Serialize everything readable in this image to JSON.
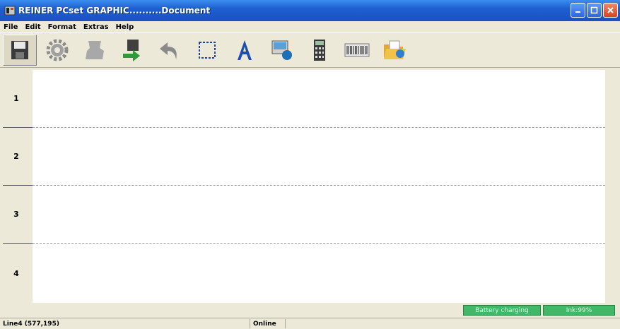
{
  "window": {
    "title": "REINER PCset GRAPHIC..........Document"
  },
  "menu": {
    "items": [
      "File",
      "Edit",
      "Format",
      "Extras",
      "Help"
    ]
  },
  "toolbar": {
    "tools": [
      "save-icon",
      "gear-icon",
      "stamp-icon",
      "print-transfer-icon",
      "undo-icon",
      "selection-rectangle-icon",
      "text-icon",
      "image-icon",
      "calculator-icon",
      "barcode-icon",
      "open-folder-icon"
    ]
  },
  "document": {
    "rows": [
      "1",
      "2",
      "3",
      "4"
    ]
  },
  "indicators": {
    "battery": "Battery charging",
    "ink": "Ink:99%"
  },
  "status": {
    "position": "Line4 (577,195)",
    "connection": "Online"
  },
  "colors": {
    "titlebar": "#1e5fd0",
    "indicator": "#40b868",
    "background": "#ece9d8"
  }
}
